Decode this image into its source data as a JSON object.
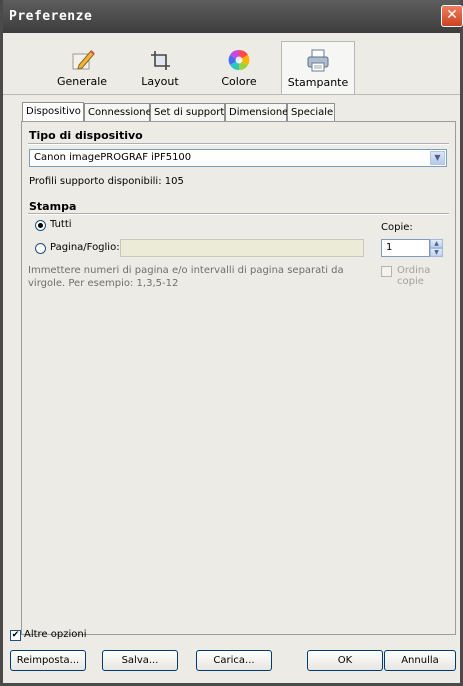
{
  "window": {
    "title": "Preferenze",
    "close_symbol": "✕"
  },
  "toolbar": {
    "items": [
      {
        "label": "Generale",
        "icon": "pencil-icon"
      },
      {
        "label": "Layout",
        "icon": "crop-icon"
      },
      {
        "label": "Colore",
        "icon": "color-wheel-icon"
      },
      {
        "label": "Stampante",
        "icon": "printer-icon",
        "active": true
      }
    ]
  },
  "tabs": [
    "Dispositivo",
    "Connessione",
    "Set di supporti",
    "Dimensione",
    "Speciale"
  ],
  "device": {
    "section_title": "Tipo di dispositivo",
    "selected": "Canon imagePROGRAF iPF5100",
    "profiles_text": "Profili supporto disponibili: 105"
  },
  "print": {
    "section_title": "Stampa",
    "option_all": "Tutti",
    "option_pages": "Pagina/Foglio:",
    "pages_value": "",
    "hint": "Immettere numeri di pagina e/o intervalli di pagina separati da virgole. Per esempio: 1,3,5-12",
    "copies_label": "Copie:",
    "copies_value": "1",
    "collate_label": "Ordina copie"
  },
  "footer": {
    "more_options_label": "Altre opzioni",
    "buttons": {
      "reset": "Reimposta...",
      "save": "Salva...",
      "load": "Carica...",
      "ok": "OK",
      "cancel": "Annulla"
    }
  }
}
